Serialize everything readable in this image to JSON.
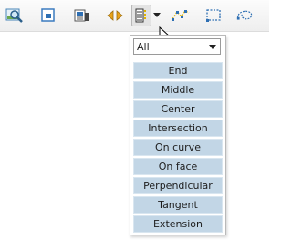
{
  "toolbar": {
    "buttons": [
      {
        "id": "zoom-extents",
        "icon": "zoom-extents-icon"
      },
      {
        "id": "frame",
        "icon": "frame-square-icon"
      },
      {
        "id": "properties",
        "icon": "properties-icon"
      },
      {
        "id": "arrows",
        "icon": "left-right-arrows-icon"
      },
      {
        "id": "snap-list",
        "icon": "snap-list-icon"
      },
      {
        "id": "polyline",
        "icon": "polyline-snap-icon"
      },
      {
        "id": "rect-select",
        "icon": "rect-select-icon"
      },
      {
        "id": "lasso",
        "icon": "lasso-icon"
      }
    ]
  },
  "dropdown": {
    "filter_value": "All",
    "options": [
      "End",
      "Middle",
      "Center",
      "Intersection",
      "On curve",
      "On face",
      "Perpendicular",
      "Tangent",
      "Extension"
    ]
  }
}
